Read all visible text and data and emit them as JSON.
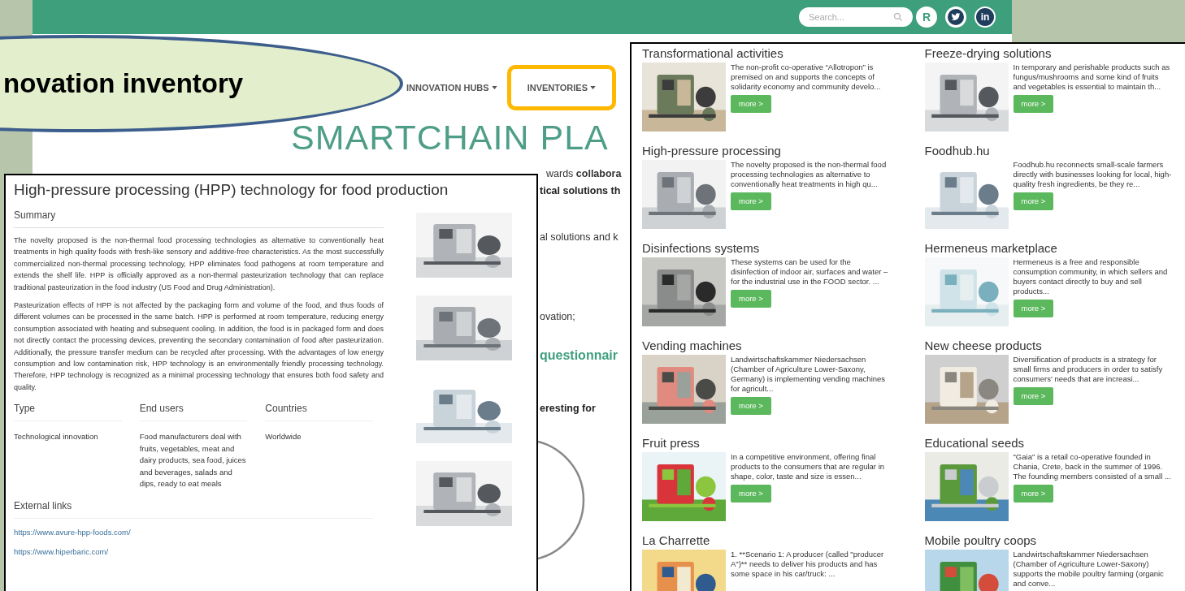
{
  "slide": {
    "callout": "novation inventory"
  },
  "site": {
    "search": {
      "placeholder": "Search..."
    },
    "social": [
      {
        "kind": "researchgate",
        "label": "R"
      },
      {
        "kind": "twitter"
      },
      {
        "kind": "linkedin",
        "label": "in"
      }
    ],
    "nav": [
      {
        "label": "INNOVATION HUBS",
        "highlighted": false
      },
      {
        "label": "INVENTORIES",
        "highlighted": true
      }
    ],
    "title": "SMARTCHAIN PLA",
    "fragments": [
      {
        "kind": "text",
        "text": "wards **collabora**"
      },
      {
        "kind": "bold",
        "text": "tical solutions th"
      },
      {
        "kind": "text",
        "text": "al solutions and k"
      },
      {
        "kind": "text",
        "text": "ovation;"
      },
      {
        "kind": "link",
        "text": "questionnair"
      },
      {
        "kind": "bold",
        "text": "eresting for"
      }
    ]
  },
  "detail": {
    "title": "High-pressure processing (HPP) technology for food production",
    "summary_heading": "Summary",
    "paragraphs": [
      "The novelty proposed is the non-thermal food processing technologies as alternative to conventionally heat treatments in high quality foods with fresh-like sensory and additive-free characteristics. As the most successfully commercialized non-thermal processing technology, HPP eliminates food pathogens at room temperature and extends the shelf life. HPP is officially approved as a non-thermal pasteurization technology that can replace traditional pasteurization in the food industry (US Food and Drug Administration).",
      "Pasteurization effects of HPP is not affected by the packaging form and volume of the food, and thus foods of different volumes can be processed in the same batch. HPP is performed at room temperature, reducing energy consumption associated with heating and subsequent cooling. In addition, the food is in packaged form and does not directly contact the processing devices, preventing the secondary contamination of food after pasteurization. Additionally, the pressure transfer medium can be recycled after processing. With the advantages of low energy consumption and low contamination risk, HPP technology is an environmentally friendly processing technology. Therefore, HPP technology is recognized as a minimal processing technology that ensures both food safety and quality."
    ],
    "meta": [
      {
        "heading": "Type",
        "value": "Technological innovation"
      },
      {
        "heading": "End users",
        "value": "Food manufacturers deal with fruits, vegetables, meat and dairy products, sea food, juices and beverages, salads and dips, ready to eat meals"
      },
      {
        "heading": "Countries",
        "value": "Worldwide"
      }
    ],
    "links_heading": "External links",
    "links": [
      "https://www.avure-hpp-foods.com/",
      "https://www.hiperbaric.com/"
    ],
    "images": [
      {
        "kind": "picture"
      },
      {
        "kind": "picture"
      },
      {
        "kind": "picture"
      },
      {
        "kind": "picture"
      }
    ]
  },
  "inventory": [
    {
      "title": "Transformational activities",
      "text": "The non-profit co-operative “Allotropon” is premised on and supports the concepts of solidarity economy and community develo...",
      "button": "more >"
    },
    {
      "title": "Freeze-drying solutions",
      "text": "In temporary and perishable products such as fungus/mushrooms and some kind of fruits and vegetables is essential to maintain th...",
      "button": "more >"
    },
    {
      "title": "High-pressure processing",
      "text": "The novelty proposed is the non-thermal food processing technologies as alternative to conventionally heat treatments in high qu...",
      "button": "more >"
    },
    {
      "title": "Foodhub.hu",
      "text": "Foodhub.hu reconnects small-scale farmers directly with businesses looking for local, high-quality fresh ingredients, be they re...",
      "button": "more >"
    },
    {
      "title": "Disinfections systems",
      "text": "These systems can be used for the disinfection of indoor air, surfaces and water – for the industrial use in the FOOD sector. ...",
      "button": "more >"
    },
    {
      "title": "Hermeneus marketplace",
      "text": "Hermeneus is a free and responsible consumption community, in which sellers and buyers contact directly to buy and sell products...",
      "button": "more >"
    },
    {
      "title": "Vending machines",
      "text": "Landwirtschaftskammer Niedersachsen (Chamber of Agriculture Lower-Saxony, Germany) is implementing vending machines for agricult...",
      "button": "more >"
    },
    {
      "title": "New cheese products",
      "text": "Diversification of products is a strategy for small firms and producers in order to satisfy consumers' needs that are increasi...",
      "button": "more >"
    },
    {
      "title": "Fruit press",
      "text": "In a competitive environment, offering final products to the consumers that are regular in shape, color, taste and size is essen...",
      "button": "more >"
    },
    {
      "title": "Educational seeds",
      "text": "\"Gaia\" is a retail co-operative founded in Chania, Crete, back in the summer of 1996. The founding members consisted of a small ...",
      "button": "more >"
    },
    {
      "title": "La Charrette",
      "text": "1. **Scenario 1: A producer (called \"producer A\")** needs to deliver his products and has some space in his car/truck: ..."
    },
    {
      "title": "Mobile poultry coops",
      "text": "Landwirtschaftskammer Niedersachsen (Chamber of Agriculture Lower-Saxony) supports the mobile poultry farming (organic and conve..."
    }
  ]
}
